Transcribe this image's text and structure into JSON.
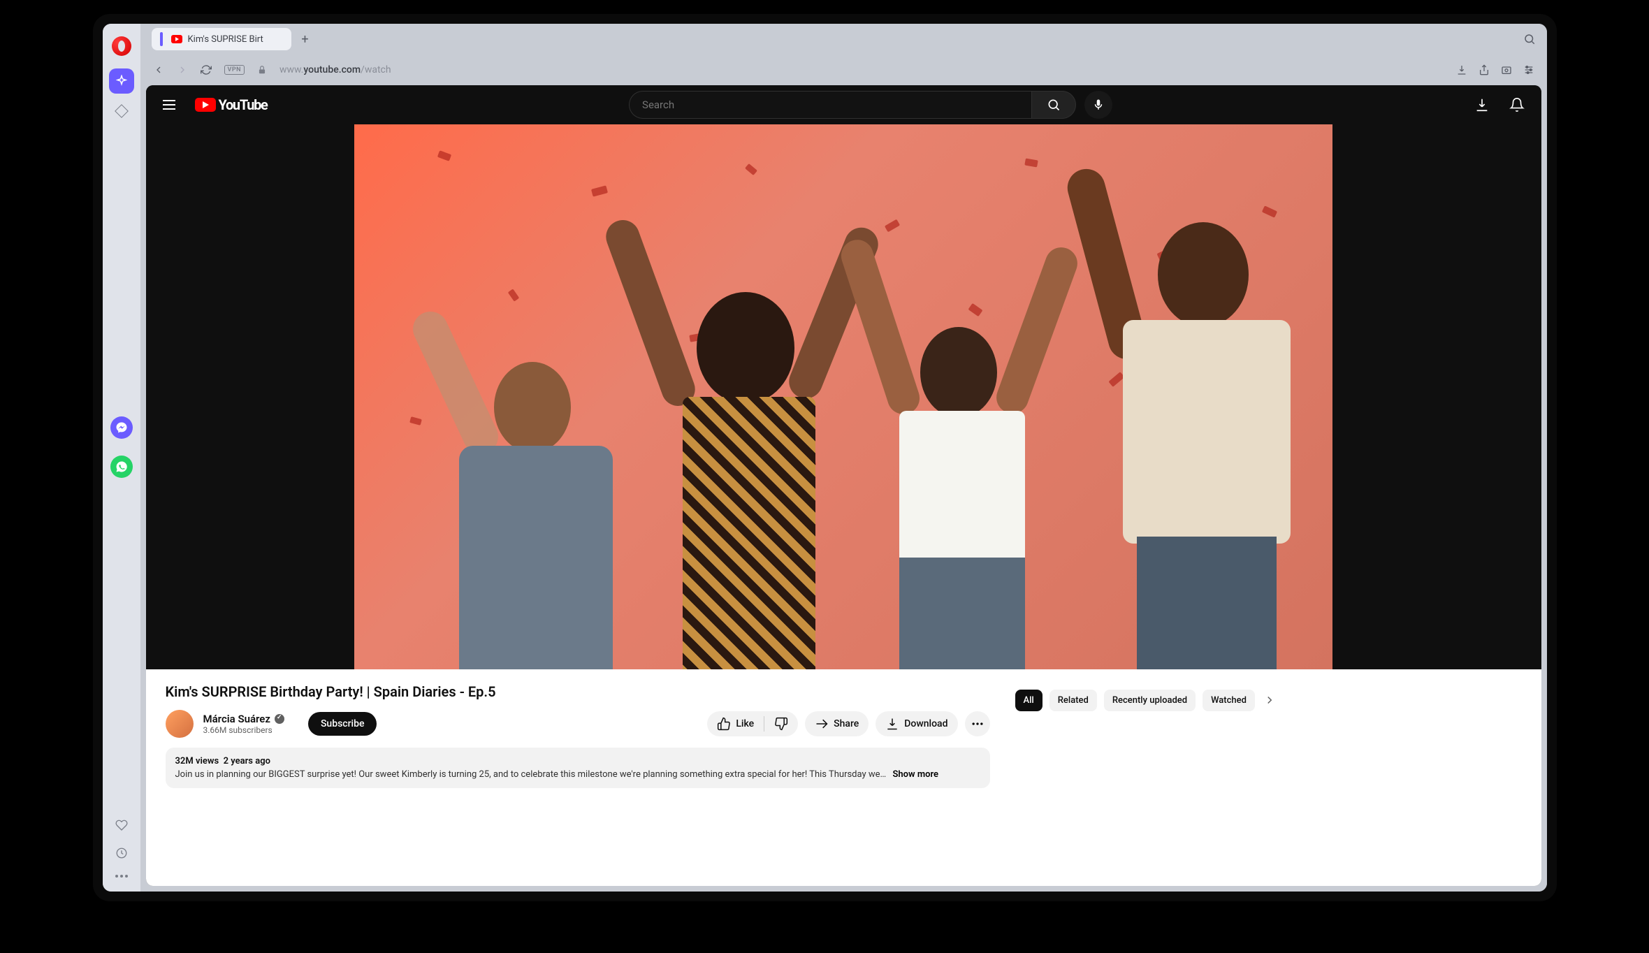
{
  "browser": {
    "tab_title": "Kim's SUPRISE Birt",
    "url_prefix": "www.",
    "url_domain": "youtube.com",
    "url_path": "/watch",
    "vpn_label": "VPN"
  },
  "youtube_header": {
    "logo_text": "YouTube",
    "search_placeholder": "Search"
  },
  "video": {
    "title": "Kim's SURPRISE Birthday Party! | Spain Diaries - Ep.5",
    "channel_name": "Márcia Suárez",
    "subscribers": "3.66M subscribers",
    "subscribe_label": "Subscribe",
    "actions": {
      "like": "Like",
      "share": "Share",
      "download": "Download"
    },
    "desc_views": "32M views",
    "desc_age": "2 years ago",
    "description": "Join us in planning our BIGGEST surprise yet! Our sweet Kimberly is turning 25, and to celebrate this milestone we're planning something extra special for her! This Thursday we…",
    "show_more": "Show more"
  },
  "chips": [
    "All",
    "Related",
    "Recently uploaded",
    "Watched"
  ]
}
